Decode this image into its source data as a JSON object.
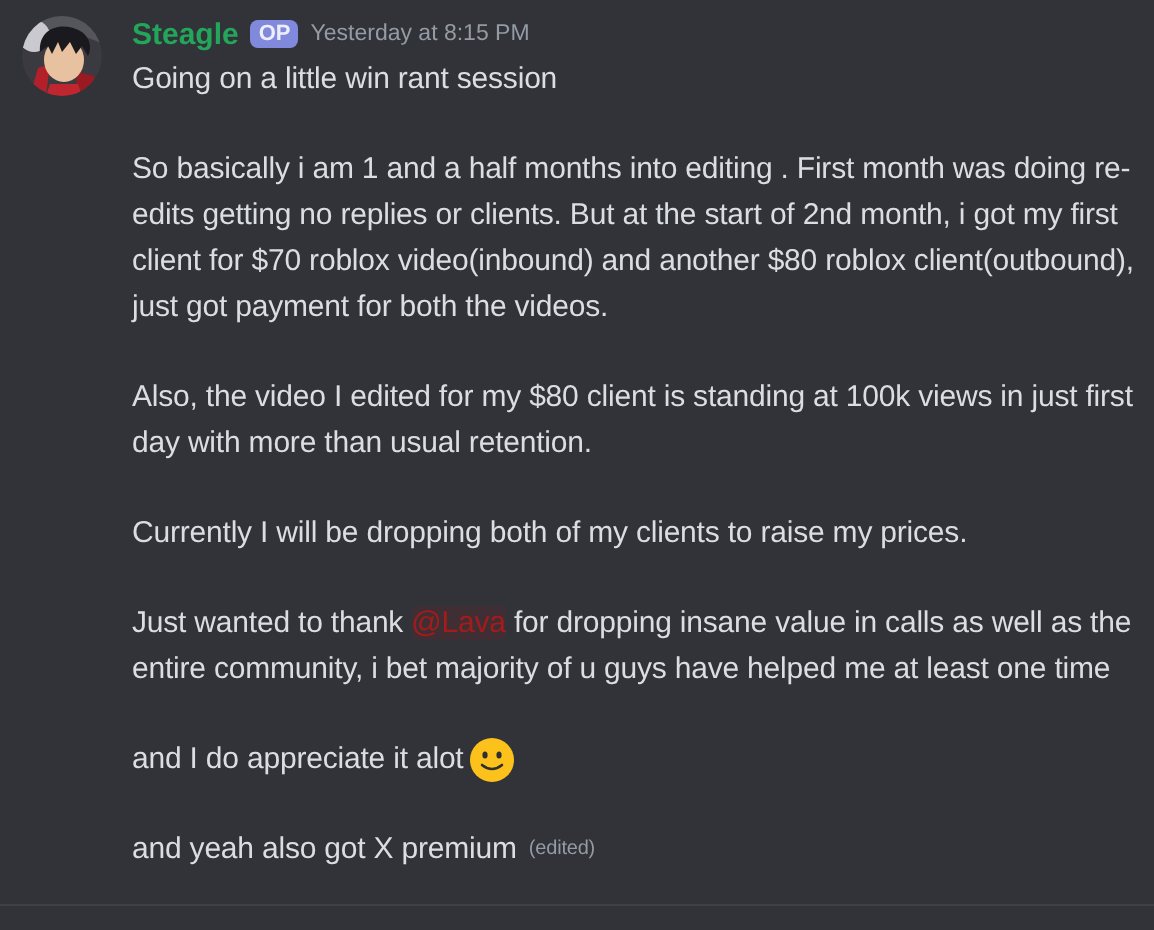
{
  "message": {
    "author": "Steagle",
    "badge": "OP",
    "timestamp": "Yesterday at 8:15 PM",
    "paragraphs": [
      {
        "segments": [
          {
            "kind": "text",
            "text": "Going on a little win rant session"
          }
        ]
      },
      {
        "segments": [
          {
            "kind": "text",
            "text": "So basically i am 1 and a half months into editing . First month was doing re-edits getting no replies or clients. But at the start of 2nd month, i got my first client for $70 roblox video(inbound) and another $80 roblox client(outbound), just got payment for both the videos."
          }
        ]
      },
      {
        "segments": [
          {
            "kind": "text",
            "text": "Also, the video I edited for my $80 client is standing at 100k views in just first day with more than usual retention."
          }
        ]
      },
      {
        "segments": [
          {
            "kind": "text",
            "text": "Currently I will be dropping both of my clients to raise my prices."
          }
        ]
      },
      {
        "segments": [
          {
            "kind": "text",
            "text": "Just wanted to thank "
          },
          {
            "kind": "mention",
            "text": "@Lava"
          },
          {
            "kind": "text",
            "text": " for dropping insane value in calls as well as the entire community, i bet majority of u guys have helped me at least one time"
          }
        ]
      },
      {
        "segments": [
          {
            "kind": "text",
            "text": "and I do appreciate it alot"
          },
          {
            "kind": "emoji"
          }
        ]
      },
      {
        "segments": [
          {
            "kind": "text",
            "text": "and yeah also got X premium"
          },
          {
            "kind": "edited",
            "text": "(edited)"
          }
        ]
      }
    ]
  }
}
